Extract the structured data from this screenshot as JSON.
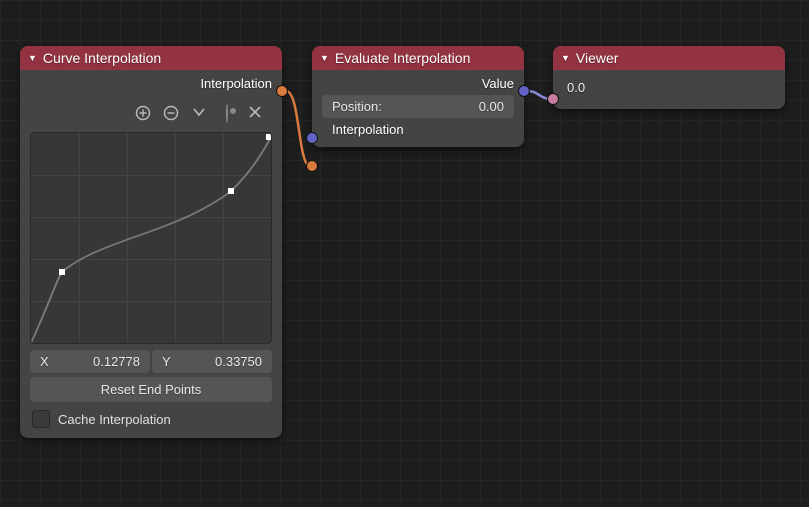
{
  "curve": {
    "title": "Curve Interpolation",
    "output": "Interpolation",
    "toolbar_icons": [
      "plus-icon",
      "minus-icon",
      "chevron-down-icon",
      "slot-icon",
      "close-icon"
    ],
    "x_label": "X",
    "x_value": "0.12778",
    "y_label": "Y",
    "y_value": "0.33750",
    "reset_button": "Reset End Points",
    "cache_label": "Cache Interpolation",
    "cache_checked": false,
    "curve_points": [
      {
        "x": 0.0,
        "y": 0.0
      },
      {
        "x": 0.128,
        "y": 0.338
      },
      {
        "x": 0.835,
        "y": 0.725
      },
      {
        "x": 1.0,
        "y": 0.98
      }
    ],
    "selected_points": [
      {
        "x": 0.128,
        "y": 0.338
      },
      {
        "x": 0.835,
        "y": 0.725
      }
    ]
  },
  "evaluate": {
    "title": "Evaluate Interpolation",
    "output": "Value",
    "position_label": "Position:",
    "position_value": "0.00",
    "interpolation_label": "Interpolation"
  },
  "viewer": {
    "title": "Viewer",
    "value": "0.0"
  }
}
